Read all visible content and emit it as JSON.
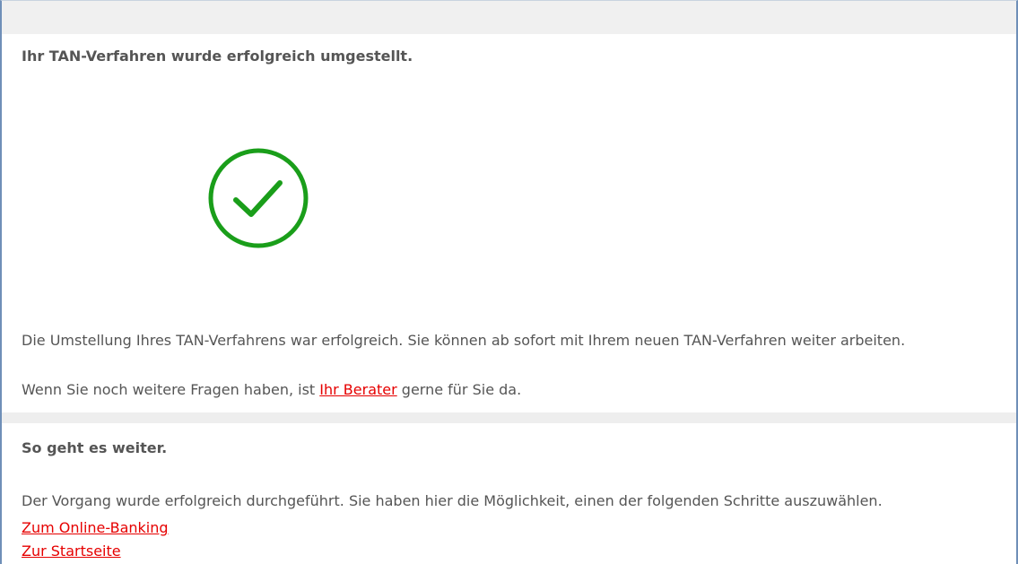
{
  "confirmation": {
    "title": "Ihr TAN-Verfahren wurde erfolgreich umgestellt.",
    "icon": "check-circle-icon",
    "icon_color": "#1a9e1a",
    "message": "Die Umstellung Ihres TAN-Verfahrens war erfolgreich. Sie können ab sofort mit Ihrem neuen TAN-Verfahren weiter arbeiten.",
    "contact_prefix": "Wenn Sie noch weitere Fragen haben, ist ",
    "contact_link": "Ihr Berater",
    "contact_suffix": " gerne für Sie da."
  },
  "next_steps": {
    "title": "So geht es weiter.",
    "description": "Der Vorgang wurde erfolgreich durchgeführt. Sie haben hier die Möglichkeit,  einen der folgenden Schritte auszuwählen.",
    "links": [
      "Zum Online-Banking",
      "Zur Startseite"
    ]
  },
  "colors": {
    "text": "#555555",
    "link": "#e60000",
    "success": "#1a9e1a",
    "section_background": "#eeeeee"
  }
}
